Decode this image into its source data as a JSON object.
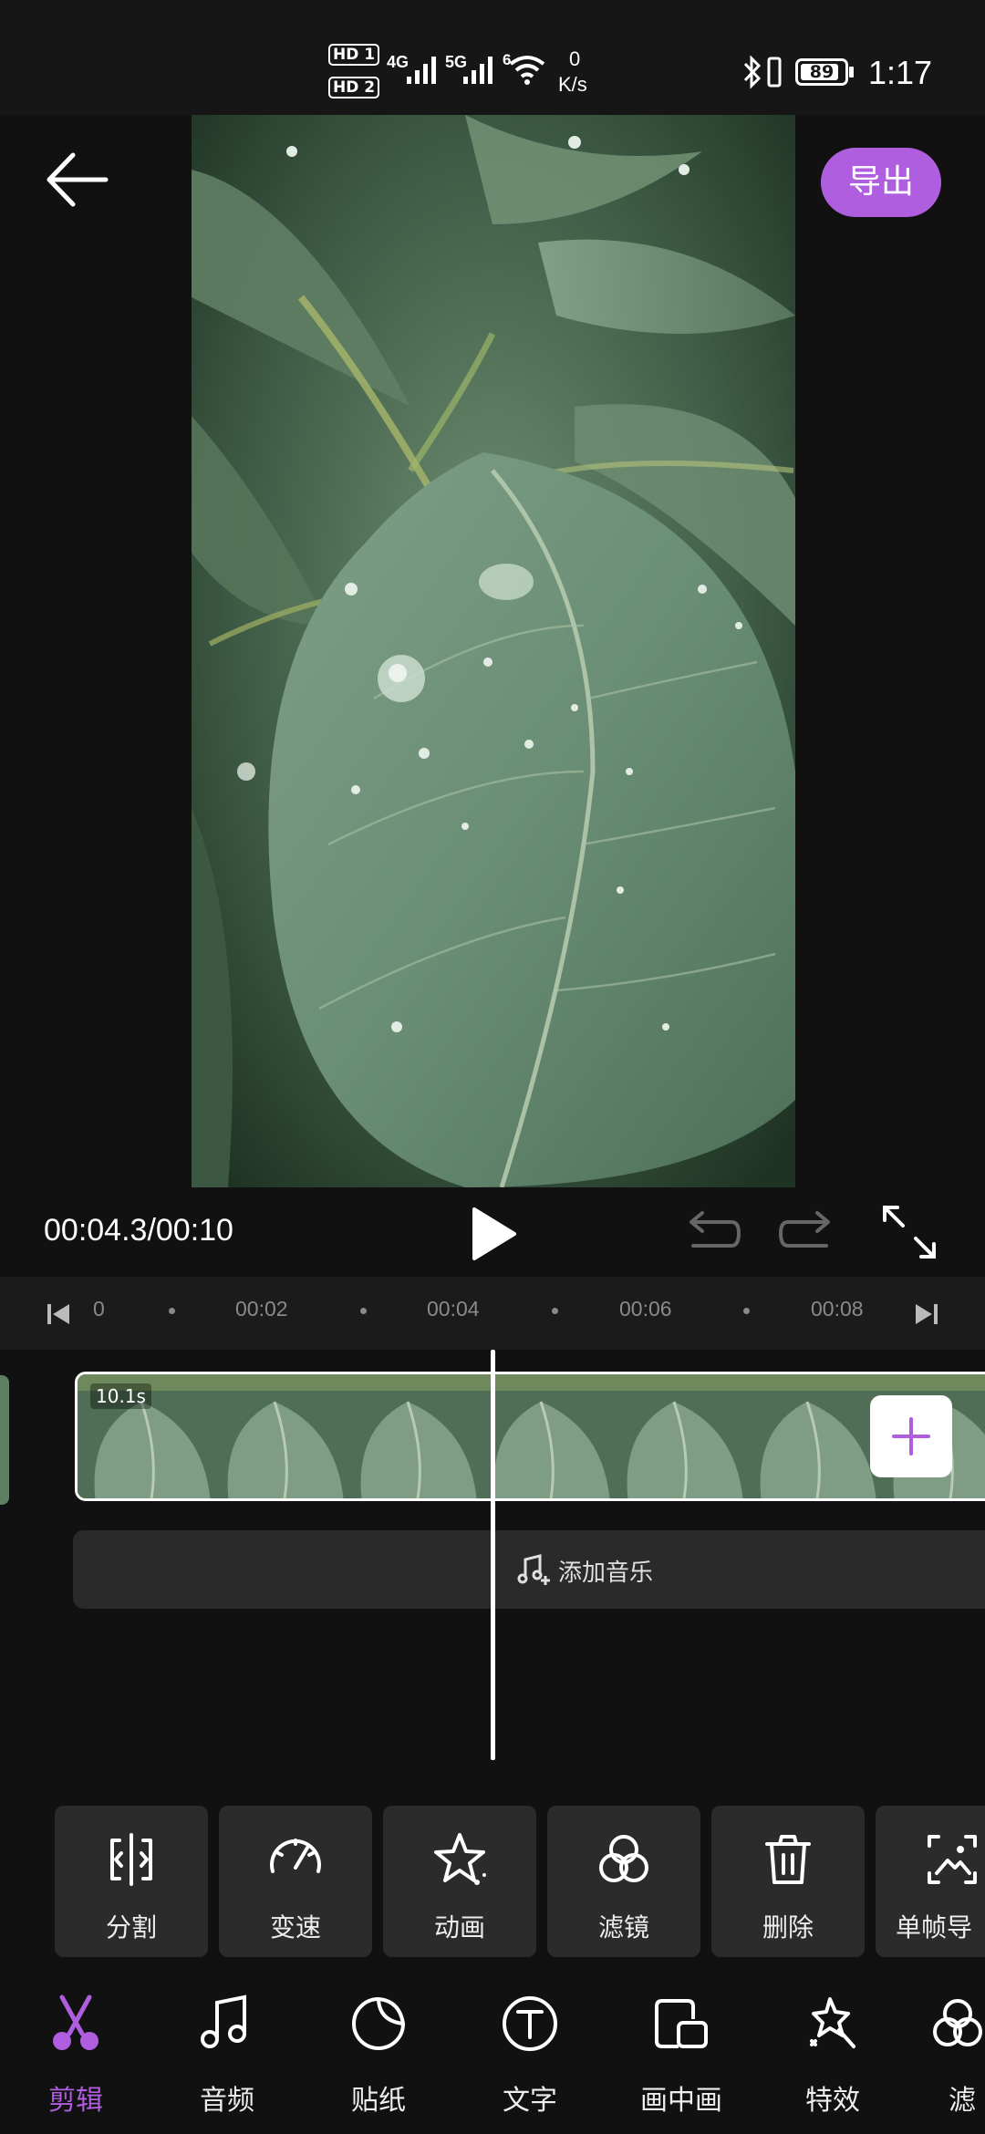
{
  "status_bar": {
    "hd1": "HD 1",
    "hd2": "HD 2",
    "net1": "4G",
    "net2": "5G",
    "wifi": "6",
    "speed_value": "0",
    "speed_unit": "K/s",
    "battery": "89",
    "time": "1:17"
  },
  "header": {
    "export_label": "导出"
  },
  "playback": {
    "time_display": "00:04.3/00:10"
  },
  "ruler": {
    "labels": [
      "0",
      "00:02",
      "00:04",
      "00:06",
      "00:08"
    ]
  },
  "track": {
    "clip_duration": "10.1s",
    "add_music_label": "添加音乐"
  },
  "tools": [
    {
      "label": "分割",
      "icon": "split-icon"
    },
    {
      "label": "变速",
      "icon": "speed-icon"
    },
    {
      "label": "动画",
      "icon": "animation-icon"
    },
    {
      "label": "滤镜",
      "icon": "filter-icon"
    },
    {
      "label": "删除",
      "icon": "trash-icon"
    },
    {
      "label": "单帧导",
      "icon": "frame-export-icon"
    }
  ],
  "nav": [
    {
      "label": "剪辑",
      "icon": "scissors-icon",
      "active": true
    },
    {
      "label": "音频",
      "icon": "music-icon"
    },
    {
      "label": "贴纸",
      "icon": "sticker-icon"
    },
    {
      "label": "文字",
      "icon": "text-icon"
    },
    {
      "label": "画中画",
      "icon": "pip-icon"
    },
    {
      "label": "特效",
      "icon": "effects-icon"
    },
    {
      "label": "滤",
      "icon": "filter-icon"
    }
  ],
  "colors": {
    "accent": "#b05ee0",
    "background": "#111111"
  }
}
